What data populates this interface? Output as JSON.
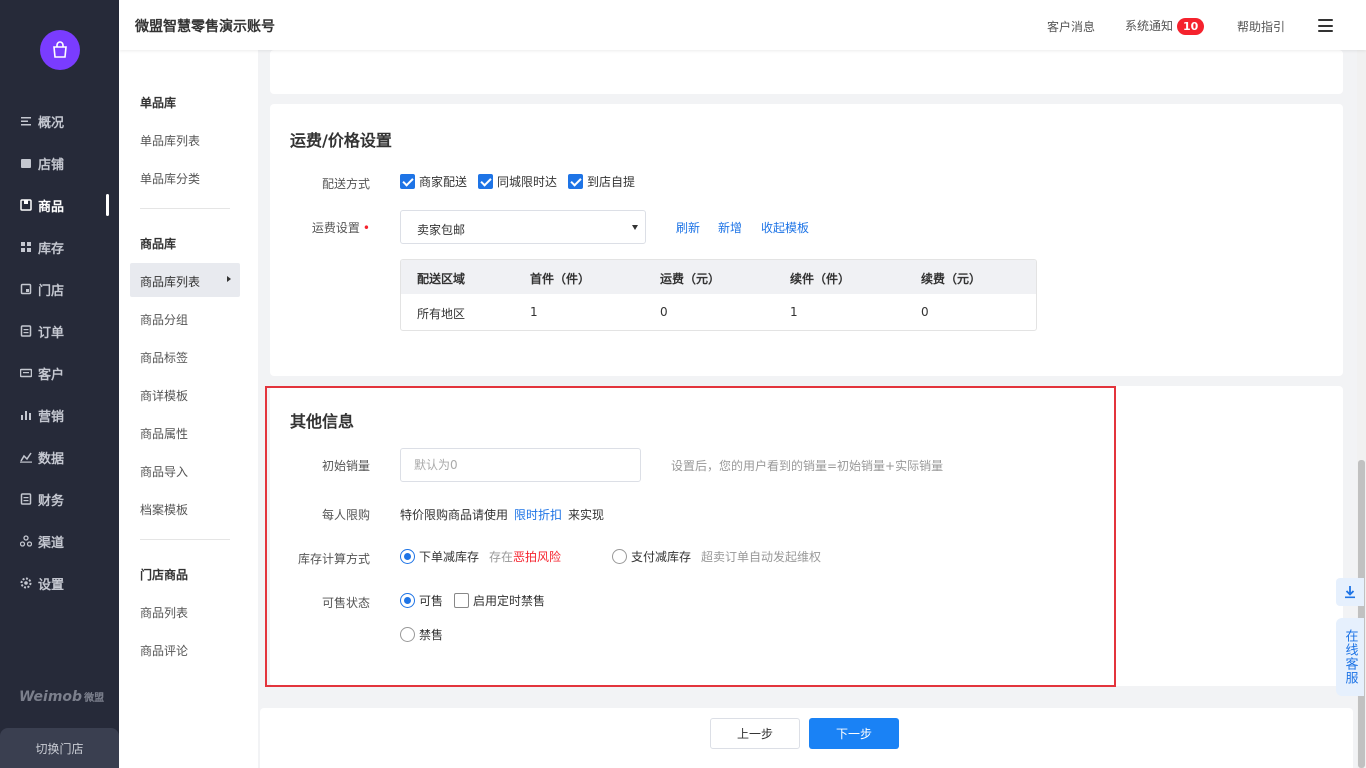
{
  "header": {
    "title": "微盟智慧零售演示账号",
    "messages": "客户消息",
    "notice": "系统通知",
    "notice_count": "10",
    "help": "帮助指引"
  },
  "nav": {
    "items": [
      {
        "label": "概况",
        "icon": "overview-icon"
      },
      {
        "label": "店铺",
        "icon": "store-icon"
      },
      {
        "label": "商品",
        "icon": "goods-icon",
        "active": true
      },
      {
        "label": "库存",
        "icon": "inventory-icon"
      },
      {
        "label": "门店",
        "icon": "shop-icon"
      },
      {
        "label": "订单",
        "icon": "order-icon"
      },
      {
        "label": "客户",
        "icon": "customer-icon"
      },
      {
        "label": "营销",
        "icon": "marketing-icon"
      },
      {
        "label": "数据",
        "icon": "data-icon"
      },
      {
        "label": "财务",
        "icon": "finance-icon"
      },
      {
        "label": "渠道",
        "icon": "channel-icon"
      },
      {
        "label": "设置",
        "icon": "settings-icon"
      }
    ],
    "brand": "Weimob",
    "brand_cn": "微盟",
    "switch_store": "切换门店"
  },
  "subnav": {
    "group1": "单品库",
    "group1_items": [
      "单品库列表",
      "单品库分类"
    ],
    "group2": "商品库",
    "group2_items": [
      "商品库列表",
      "商品分组",
      "商品标签",
      "商详模板",
      "商品属性",
      "商品导入",
      "档案模板"
    ],
    "group3": "门店商品",
    "group3_items": [
      "商品列表",
      "商品评论"
    ]
  },
  "shipping": {
    "title": "运费/价格设置",
    "delivery_label": "配送方式",
    "delivery_options": [
      "商家配送",
      "同城限时达",
      "到店自提"
    ],
    "fee_label": "运费设置",
    "fee_value": "卖家包邮",
    "refresh": "刷新",
    "add": "新增",
    "collapse": "收起模板",
    "table": {
      "headers": [
        "配送区域",
        "首件（件）",
        "运费（元）",
        "续件（件）",
        "续费（元）"
      ],
      "rows": [
        [
          "所有地区",
          "1",
          "0",
          "1",
          "0"
        ]
      ]
    }
  },
  "other": {
    "title": "其他信息",
    "initial_sales_label": "初始销量",
    "initial_sales_placeholder": "默认为0",
    "initial_sales_hint": "设置后，您的用户看到的销量=初始销量+实际销量",
    "limit_label": "每人限购",
    "limit_text_pre": "特价限购商品请使用",
    "limit_link": "限时折扣",
    "limit_text_post": "来实现",
    "stock_label": "库存计算方式",
    "stock_opt1": "下单减库存",
    "stock_opt1_hint_pre": "存在",
    "stock_opt1_hint_risk": "恶拍风险",
    "stock_opt2": "支付减库存",
    "stock_opt2_hint": "超卖订单自动发起维权",
    "sale_label": "可售状态",
    "sale_opt1": "可售",
    "sale_opt1_timer": "启用定时禁售",
    "sale_opt2": "禁售"
  },
  "footer": {
    "prev": "上一步",
    "next": "下一步"
  },
  "float": {
    "service": "在线客服"
  }
}
